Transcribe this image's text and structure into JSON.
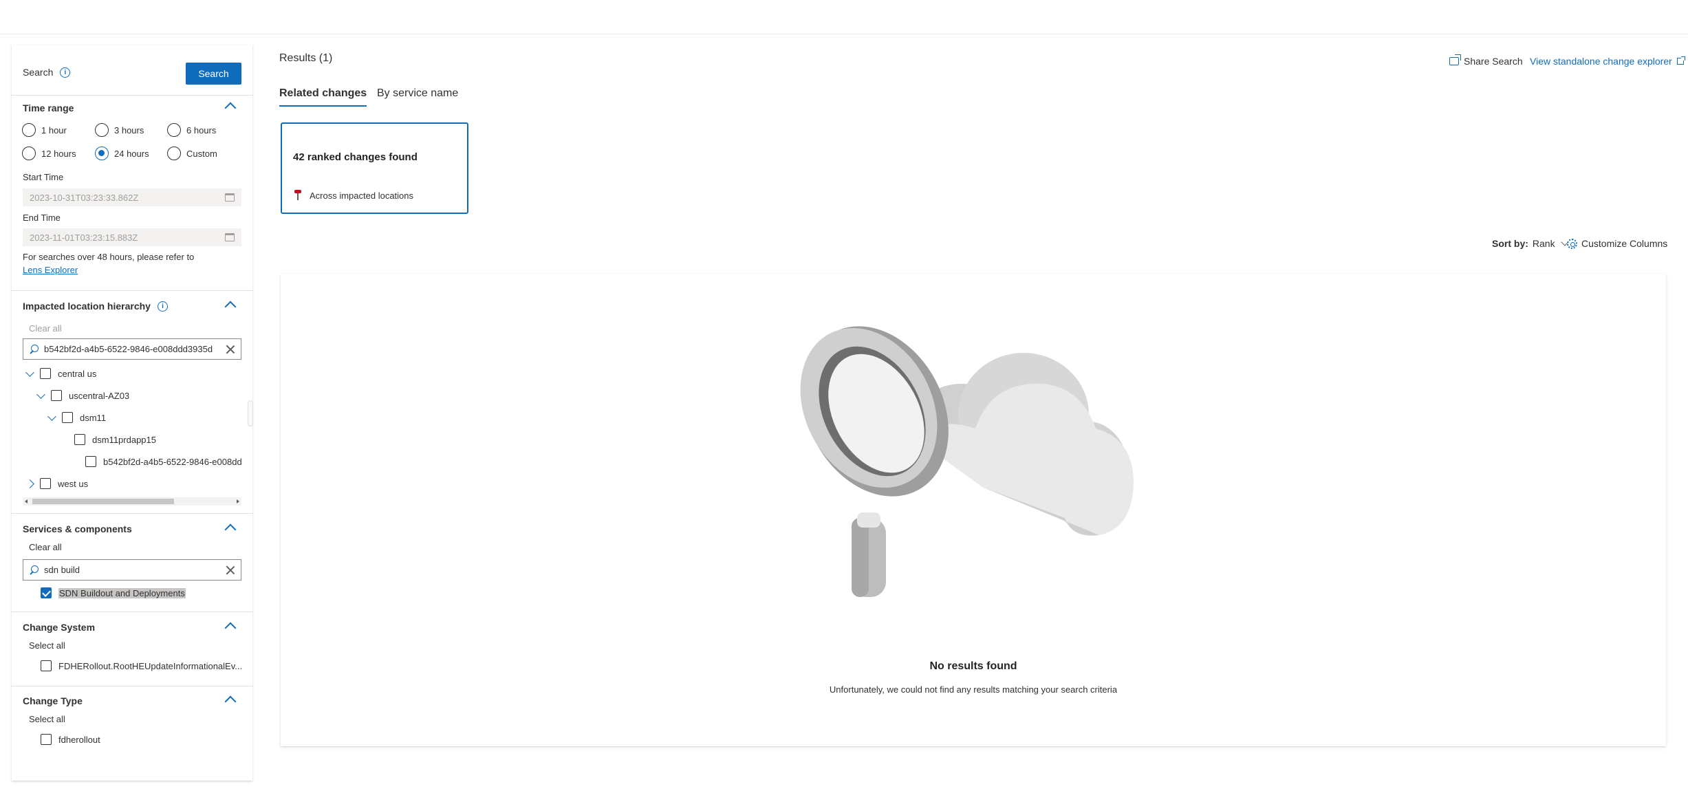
{
  "filters": {
    "search_label": "Search",
    "search_button": "Search",
    "time_range": {
      "title": "Time range",
      "options": [
        "1 hour",
        "3 hours",
        "6 hours",
        "12 hours",
        "24 hours",
        "Custom"
      ],
      "selected": "24 hours"
    },
    "start_time": {
      "label": "Start Time",
      "value": "2023-10-31T03:23:33.862Z"
    },
    "end_time": {
      "label": "End Time",
      "value": "2023-11-01T03:23:15.883Z"
    },
    "note": "For searches over 48 hours, please refer to",
    "note_link": "Lens Explorer",
    "impacted": {
      "title": "Impacted location hierarchy",
      "clear_all": "Clear all",
      "search_value": "b542bf2d-a4b5-6522-9846-e008ddd3935d",
      "tree": [
        "central us",
        "uscentral-AZ03",
        "dsm11",
        "dsm11prdapp15",
        "b542bf2d-a4b5-6522-9846-e008dd",
        "west us"
      ]
    },
    "services": {
      "title": "Services & components",
      "clear_all": "Clear all",
      "search_value": "sdn build",
      "items": [
        {
          "label": "SDN Buildout and Deployments",
          "checked": true
        }
      ]
    },
    "change_system": {
      "title": "Change System",
      "select_all": "Select all",
      "items": [
        {
          "label": "FDHERollout.RootHEUpdateInformationalEv...",
          "checked": false
        }
      ]
    },
    "change_type": {
      "title": "Change Type",
      "select_all": "Select all",
      "items": [
        {
          "label": "fdherollout",
          "checked": false
        }
      ]
    }
  },
  "main": {
    "results_title": "Results (1)",
    "tabs": [
      {
        "label": "Related changes",
        "active": true
      },
      {
        "label": "By service name",
        "active": false
      }
    ],
    "share_search": "Share Search",
    "standalone": "View standalone change explorer",
    "card": {
      "count": "42 ranked changes found",
      "sub": "Across impacted locations"
    },
    "sort_label": "Sort by:",
    "sort_value": "Rank",
    "customize": "Customize Columns",
    "empty_title": "No results found",
    "empty_sub": "Unfortunately, we could not find any results matching your search criteria"
  },
  "colors": {
    "accent": "#0f6cbd",
    "border": "#8a8886",
    "muted": "#a19f9d"
  }
}
